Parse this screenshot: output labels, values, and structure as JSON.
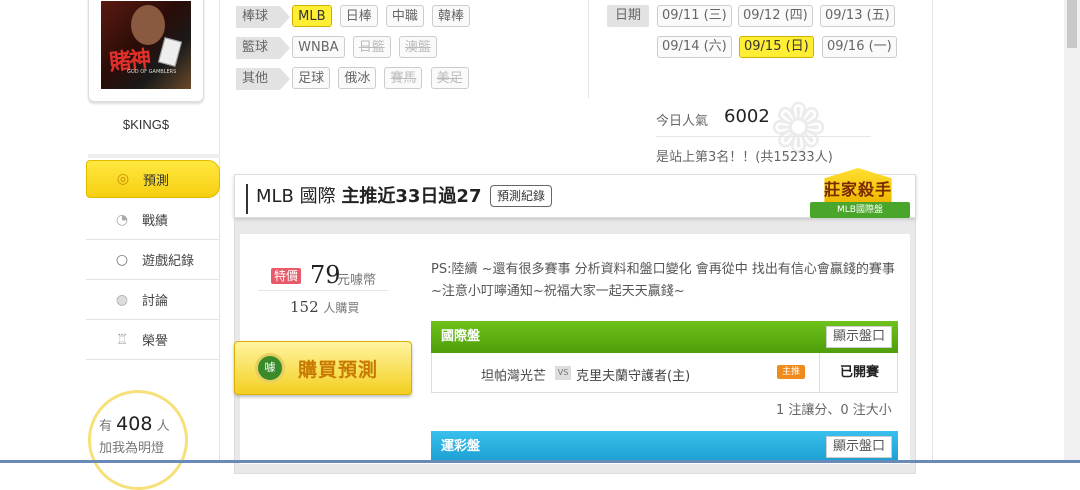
{
  "user": {
    "name": "$KING$",
    "avatar_title": "賭神",
    "avatar_subtitle": "GOD OF GAMBLERS"
  },
  "nav": [
    {
      "label": "預測",
      "icon": "target-icon",
      "active": true
    },
    {
      "label": "戰績",
      "icon": "chart-icon",
      "active": false
    },
    {
      "label": "遊戲紀錄",
      "icon": "ring-icon",
      "active": false
    },
    {
      "label": "討論",
      "icon": "chat-icon",
      "active": false
    },
    {
      "label": "榮譽",
      "icon": "medal-icon",
      "active": false
    }
  ],
  "fans": {
    "prefix": "有",
    "count": "408",
    "suffix": "人",
    "cta": "加我為明燈"
  },
  "filters": {
    "baseball": {
      "label": "棒球",
      "items": [
        "MLB",
        "日棒",
        "中職",
        "韓棒"
      ]
    },
    "basketball": {
      "label": "籃球",
      "items": [
        "WNBA",
        "日籃",
        "澳籃"
      ]
    },
    "other": {
      "label": "其他",
      "items": [
        "足球",
        "俄冰",
        "賽馬",
        "美足"
      ]
    }
  },
  "dates": {
    "label": "日期",
    "items": [
      "09/11 (三)",
      "09/12 (四)",
      "09/13 (五)",
      "09/14 (六)",
      "09/15 (日)",
      "09/16 (一)"
    ],
    "selected": "09/15 (日)"
  },
  "popularity": {
    "label": "今日人氣",
    "value": "6002",
    "rank_text": "是站上第3名！！(共15233人)"
  },
  "prediction": {
    "league": "MLB 國際",
    "headline": "主推近33日過27",
    "records_button": "預測紀錄",
    "badge_title": "莊家殺手",
    "badge_ribbon": "MLB國際盤",
    "price_tag": "特價",
    "price": "79",
    "price_unit": "元噱幣",
    "buyers": "152",
    "buyers_unit": "人購買",
    "buy_button": "購買預測",
    "buy_icon_text": "噱",
    "description": "PS:陸續 ~還有很多賽事 分析資料和盤口變化 會再從中 找出有信心會贏錢的賽事~注意小叮嚀通知~祝福大家一起天天贏錢~"
  },
  "sections": [
    {
      "title": "國際盤",
      "show_button": "顯示盤口",
      "matches": [
        {
          "away": "坦帕灣光芒",
          "vs": "VS",
          "home": "克里夫蘭守護者(主)",
          "badge": "主推",
          "status": "已開賽"
        }
      ],
      "summary": "1 注讓分、0 注大小"
    },
    {
      "title": "運彩盤",
      "show_button": "顯示盤口"
    }
  ]
}
